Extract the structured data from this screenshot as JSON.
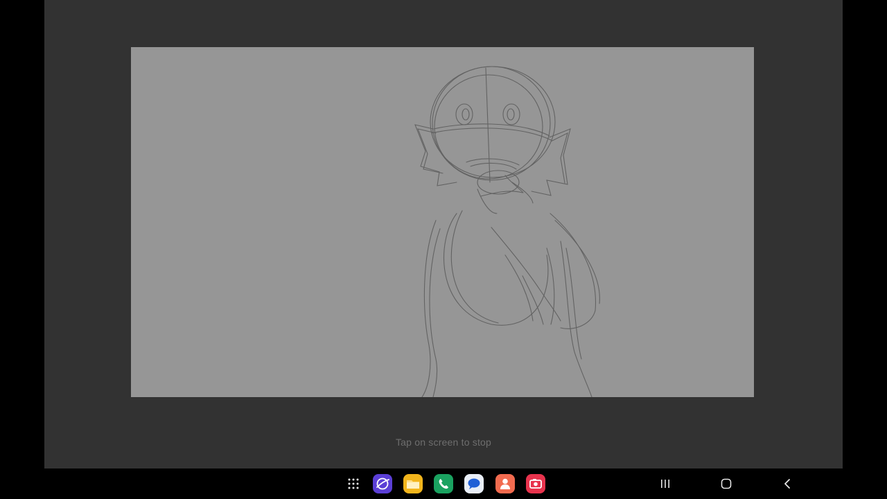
{
  "app": {
    "hint_text": "Tap on screen to stop",
    "background_color": "#323232",
    "canvas_color": "#969696"
  },
  "taskbar": {
    "dock": [
      {
        "name": "app-drawer-icon",
        "color": "#000000"
      },
      {
        "name": "internet-browser-icon",
        "color": "#5b3fd6"
      },
      {
        "name": "my-files-icon",
        "color": "#f2b51c"
      },
      {
        "name": "phone-icon",
        "color": "#1aa260"
      },
      {
        "name": "messages-icon",
        "color": "#e9eef7"
      },
      {
        "name": "contacts-icon",
        "color": "#f26b4f"
      },
      {
        "name": "screen-recorder-icon",
        "color": "#e8334d"
      }
    ],
    "nav": [
      {
        "name": "recent-apps-icon"
      },
      {
        "name": "home-icon"
      },
      {
        "name": "back-icon"
      }
    ]
  }
}
